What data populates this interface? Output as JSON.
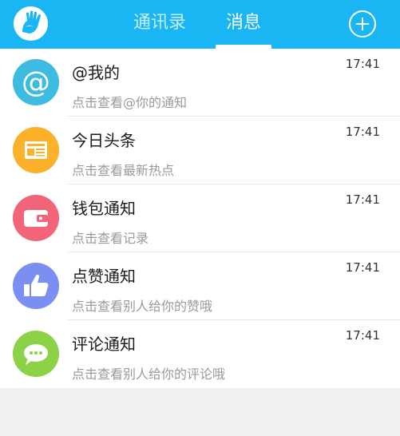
{
  "header": {
    "logo_icon": "hand-logo-icon",
    "tabs": [
      {
        "label": "通讯录",
        "active": false
      },
      {
        "label": "消息",
        "active": true
      }
    ],
    "add_icon": "plus-circle-icon",
    "bg_color": "#19b6f3"
  },
  "messages": [
    {
      "title": "@我的",
      "subtitle": "点击查看@你的通知",
      "time": "17:41",
      "icon": "at-icon",
      "color": "#3dbbe0"
    },
    {
      "title": "今日头条",
      "subtitle": "点击查看最新热点",
      "time": "17:41",
      "icon": "newspaper-icon",
      "color": "#fbb12a"
    },
    {
      "title": "钱包通知",
      "subtitle": "点击查看记录",
      "time": "17:41",
      "icon": "wallet-icon",
      "color": "#f26578"
    },
    {
      "title": "点赞通知",
      "subtitle": "点击查看别人给你的赞哦",
      "time": "17:41",
      "icon": "thumbs-up-icon",
      "color": "#7b8ff2"
    },
    {
      "title": "评论通知",
      "subtitle": "点击查看别人给你的评论哦",
      "time": "17:41",
      "icon": "chat-bubble-icon",
      "color": "#8bd246"
    }
  ]
}
